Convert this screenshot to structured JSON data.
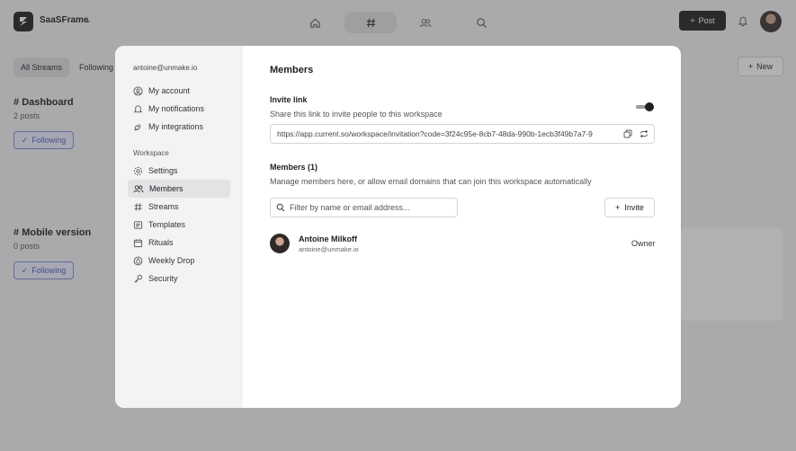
{
  "app": {
    "workspace_name": "SaaSFrame",
    "post_label": "Post",
    "new_label": "New"
  },
  "nav_icons": [
    "home-icon",
    "hash-icon",
    "people-icon",
    "search-icon"
  ],
  "subbar": {
    "tabs": [
      {
        "label": "All Streams",
        "active": true
      },
      {
        "label": "Following",
        "active": false
      }
    ]
  },
  "background_sections": [
    {
      "title": "Dashboard",
      "count": "2 posts",
      "button": "Following"
    },
    {
      "title": "Mobile version",
      "count": "0 posts",
      "button": "Following"
    }
  ],
  "modal": {
    "sidebar": {
      "email": "antoine@unmake.io",
      "account_items": [
        {
          "label": "My account",
          "icon": "user-circle-icon"
        },
        {
          "label": "My notifications",
          "icon": "bell-icon"
        },
        {
          "label": "My integrations",
          "icon": "plug-icon"
        }
      ],
      "workspace_heading": "Workspace",
      "workspace_items": [
        {
          "label": "Settings",
          "icon": "gear-icon",
          "active": false
        },
        {
          "label": "Members",
          "icon": "people-icon",
          "active": true
        },
        {
          "label": "Streams",
          "icon": "hash-icon",
          "active": false
        },
        {
          "label": "Templates",
          "icon": "template-icon",
          "active": false
        },
        {
          "label": "Rituals",
          "icon": "calendar-icon",
          "active": false
        },
        {
          "label": "Weekly Drop",
          "icon": "drop-icon",
          "active": false
        },
        {
          "label": "Security",
          "icon": "key-icon",
          "active": false
        }
      ]
    },
    "title": "Members",
    "invite_link": {
      "label": "Invite link",
      "description": "Share this link to invite people to this workspace",
      "enabled": true,
      "url": "https://app.current.so/workspace/invitation?code=3f24c95e-8cb7-48da-990b-1ecb3f49b7a7-9"
    },
    "members_section": {
      "label": "Members (1)",
      "description": "Manage members here, or allow email domains that can join this workspace automatically",
      "filter_placeholder": "Filter by name or email address...",
      "invite_label": "Invite"
    },
    "members": [
      {
        "name": "Antoine Milkoff",
        "email": "antoine@unmake.io",
        "role": "Owner"
      }
    ]
  }
}
